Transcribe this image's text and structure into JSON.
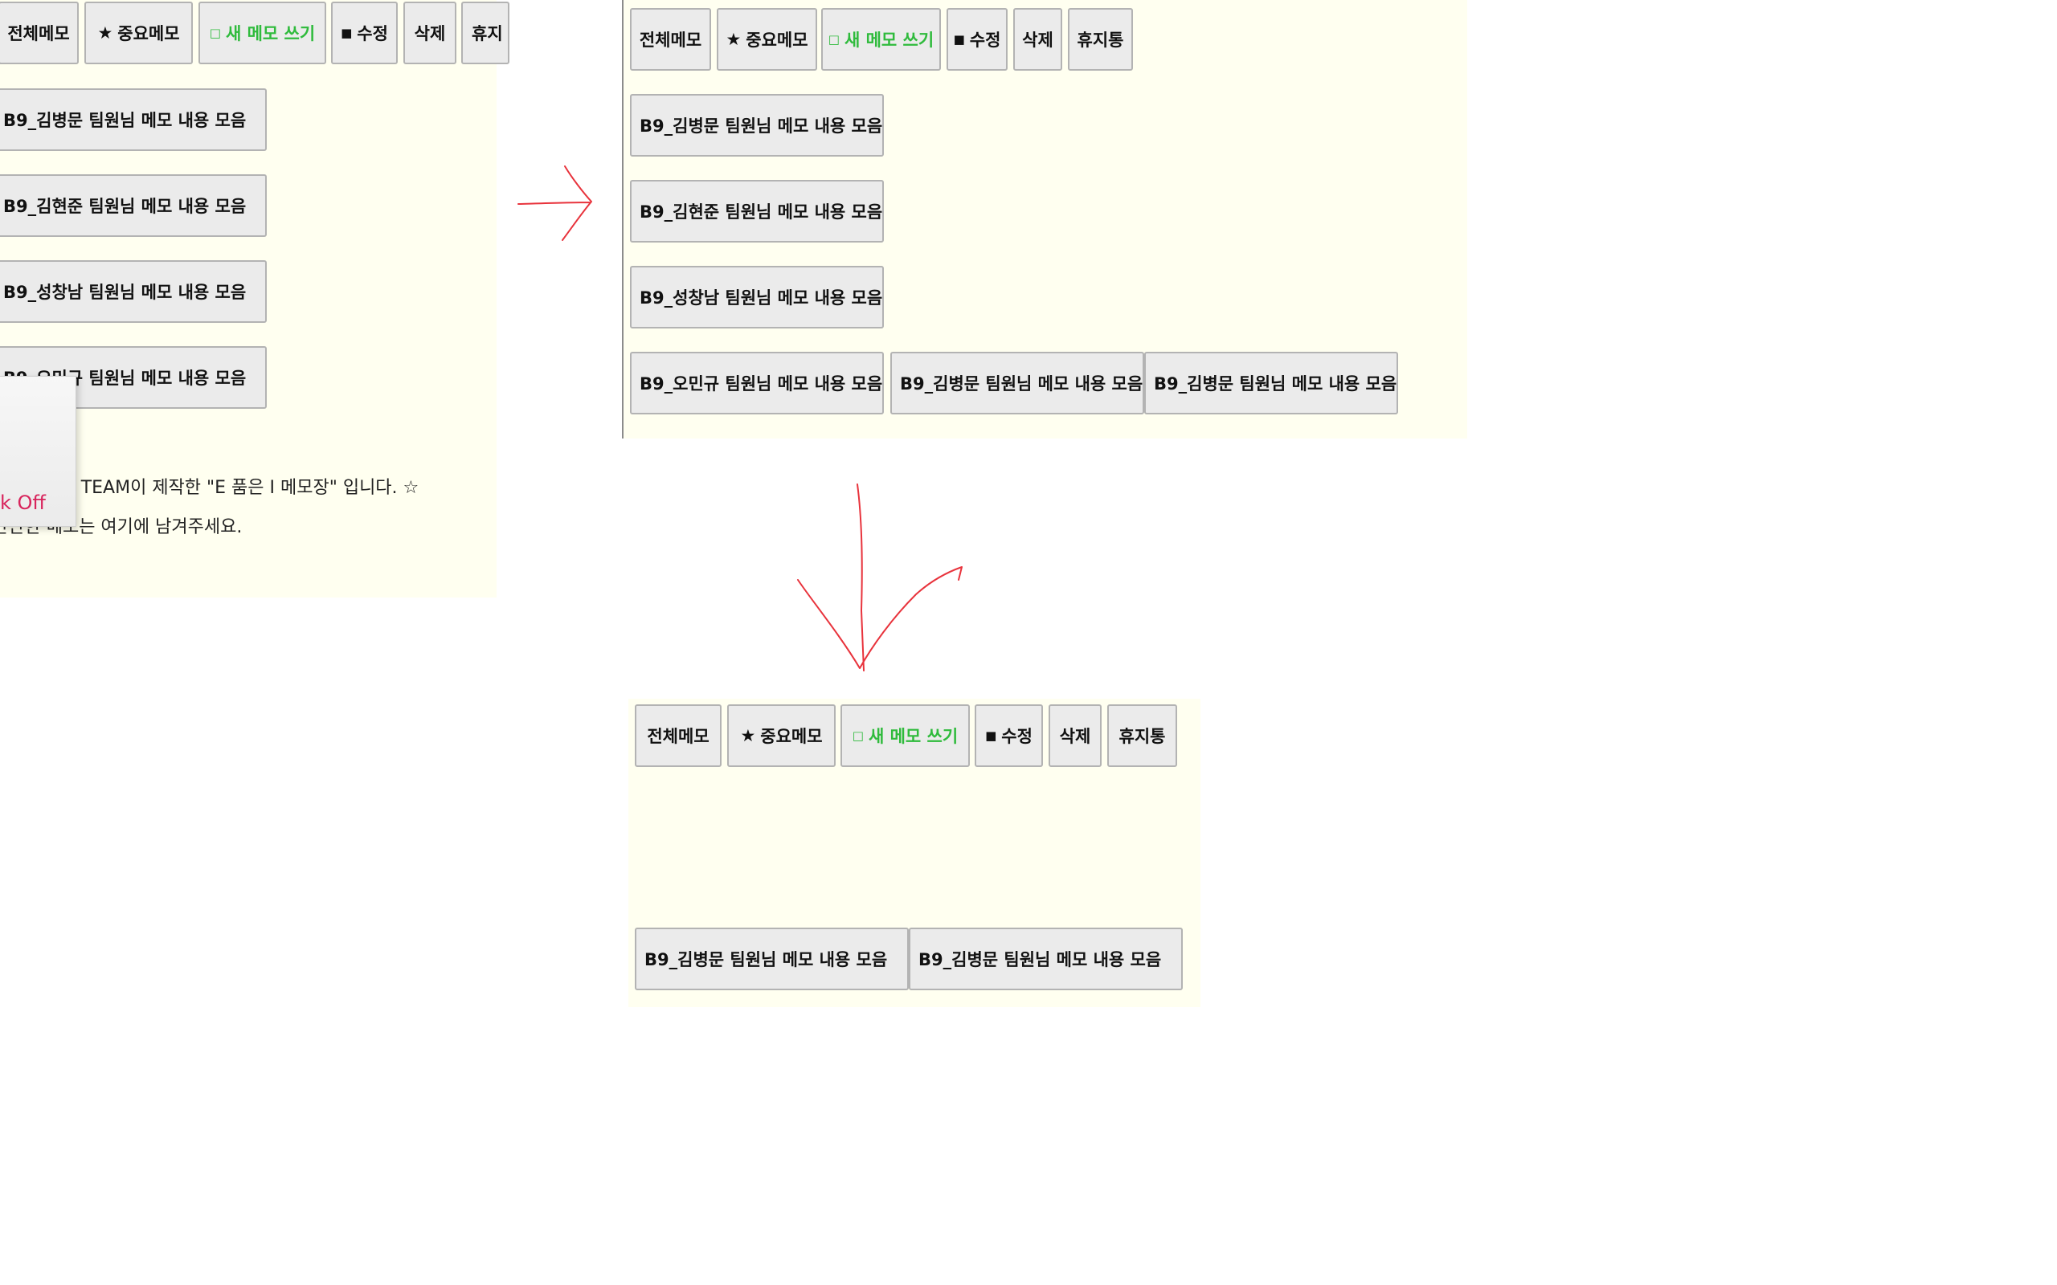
{
  "toolbar": {
    "all_memos": "전체메모",
    "important": {
      "glyph": "★",
      "label": "중요메모"
    },
    "new_memo": {
      "glyph": "□",
      "label": "새 메모 쓰기"
    },
    "edit": {
      "glyph": "■",
      "label": "수정"
    },
    "delete": "삭제",
    "trash": "휴지통",
    "trash_cut": "휴지"
  },
  "memo_titles": {
    "kim_byeongmun": "B9_김병문 팀원님 메모 내용 모음",
    "kim_hyeonjun": "B9_김현준 팀원님 메모 내용 모음",
    "seong_changnam": "B9_성창남 팀원님 메모 내용 모음",
    "oh_mingyu": "B9_오민규 팀원님 메모 내용 모음"
  },
  "notes": {
    "welcome": "여기는 S.A TEAM이 제작한 \"E 품은 I 메모장\" 입니다. ☆",
    "hint": "간단한 메모는 여기에 남겨주세요."
  },
  "popup": {
    "text": "k Off"
  },
  "colors": {
    "panel_bg": "#fffff0",
    "button_bg": "#ebebeb",
    "new_memo_text": "#2fbb3c",
    "arrow": "#e8333c",
    "popup_text": "#d8245c"
  }
}
